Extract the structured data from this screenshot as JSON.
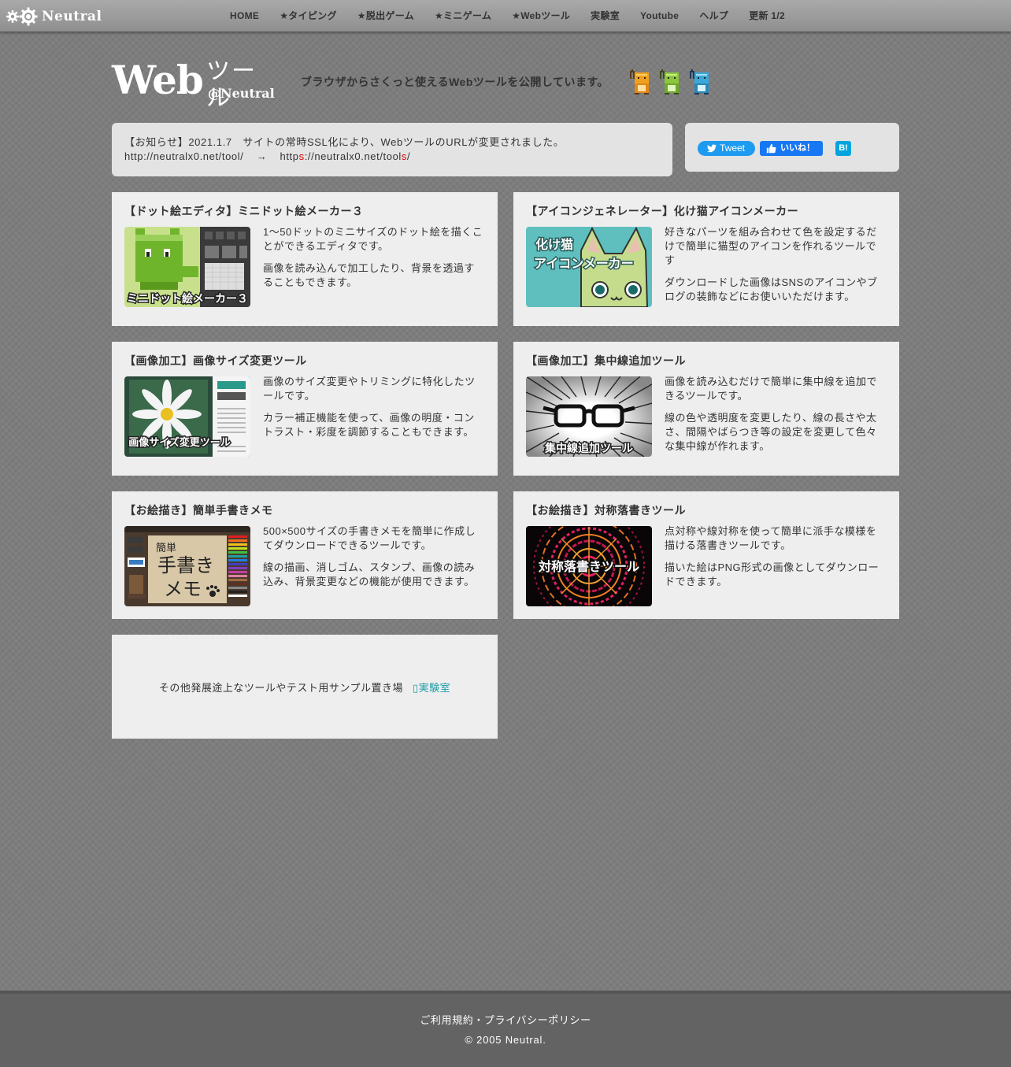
{
  "site": {
    "brand": "Neutral"
  },
  "nav": [
    {
      "label": "HOME"
    },
    {
      "label": "★タイピング"
    },
    {
      "label": "★脱出ゲーム"
    },
    {
      "label": "★ミニゲーム"
    },
    {
      "label": "★Webツール"
    },
    {
      "label": "実験室"
    },
    {
      "label": "Youtube"
    },
    {
      "label": "ヘルプ"
    },
    {
      "label": "更新 1/2"
    }
  ],
  "header": {
    "logo_main": "Web",
    "logo_sub": "ツール",
    "logo_at": "@Neutral",
    "tagline": "ブラウザからさくっと使えるWebツールを公開しています。"
  },
  "notice": {
    "line1": "【お知らせ】2021.1.7　サイトの常時SSL化により、WebツールのURLが変更されました。",
    "old_url": "http://neutralx0.net/tool/",
    "arrow": "→",
    "new_url_a": "http",
    "new_url_b": "s",
    "new_url_c": "://neutralx0.net/tool",
    "new_url_d": "s",
    "new_url_e": "/"
  },
  "social": {
    "tweet_label": "Tweet",
    "like_label": "いいね！",
    "hatena_label": "B!"
  },
  "cards": [
    {
      "title": "【ドット絵エディタ】ミニドット絵メーカー３",
      "desc1": "1～50ドットのミニサイズのドット絵を描くことができるエディタです。",
      "desc2": "画像を読み込んで加工したり、背景を透過することもできます。",
      "thumb_label": "ミニドット絵メーカー３"
    },
    {
      "title": "【アイコンジェネレーター】化け猫アイコンメーカー",
      "desc1": "好きなパーツを組み合わせて色を設定するだけで簡単に猫型のアイコンを作れるツールです",
      "desc2": "ダウンロードした画像はSNSのアイコンやブログの装飾などにお使いいただけます。",
      "thumb_label_1": "化け猫",
      "thumb_label_2": "アイコンメーカー"
    },
    {
      "title": "【画像加工】画像サイズ変更ツール",
      "desc1": "画像のサイズ変更やトリミングに特化したツールです。",
      "desc2": "カラー補正機能を使って、画像の明度・コントラスト・彩度を調節することもできます。",
      "thumb_label": "画像サイズ変更ツール"
    },
    {
      "title": "【画像加工】集中線追加ツール",
      "desc1": "画像を読み込むだけで簡単に集中線を追加できるツールです。",
      "desc2": "線の色や透明度を変更したり、線の長さや太さ、間隔やばらつき等の設定を変更して色々な集中線が作れます。",
      "thumb_label": "集中線追加ツール"
    },
    {
      "title": "【お絵描き】簡単手書きメモ",
      "desc1": "500×500サイズの手書きメモを簡単に作成してダウンロードできるツールです。",
      "desc2": "線の描画、消しゴム、スタンプ、画像の読み込み、背景変更などの機能が使用できます。",
      "thumb_label_1": "簡単",
      "thumb_label_2": "手書き",
      "thumb_label_3": "メモ"
    },
    {
      "title": "【お絵描き】対称落書きツール",
      "desc1": "点対称や線対称を使って簡単に派手な模様を描ける落書きツールです。",
      "desc2": "描いた絵はPNG形式の画像としてダウンロードできます。",
      "thumb_label": "対称落書きツール"
    }
  ],
  "lab": {
    "text": "その他発展途上なツールやテスト用サンプル置き場",
    "link_label": "実験室"
  },
  "footer": {
    "link": "ご利用規約・プライバシーポリシー",
    "copyright": "© 2005 Neutral."
  },
  "colors": {
    "background": "#7d7d7d",
    "card": "#eeeeee",
    "footer": "#636363",
    "link": "#1a9aa8",
    "tweet": "#1d9bf0",
    "facebook": "#1877f2",
    "hatena": "#00a4de"
  }
}
